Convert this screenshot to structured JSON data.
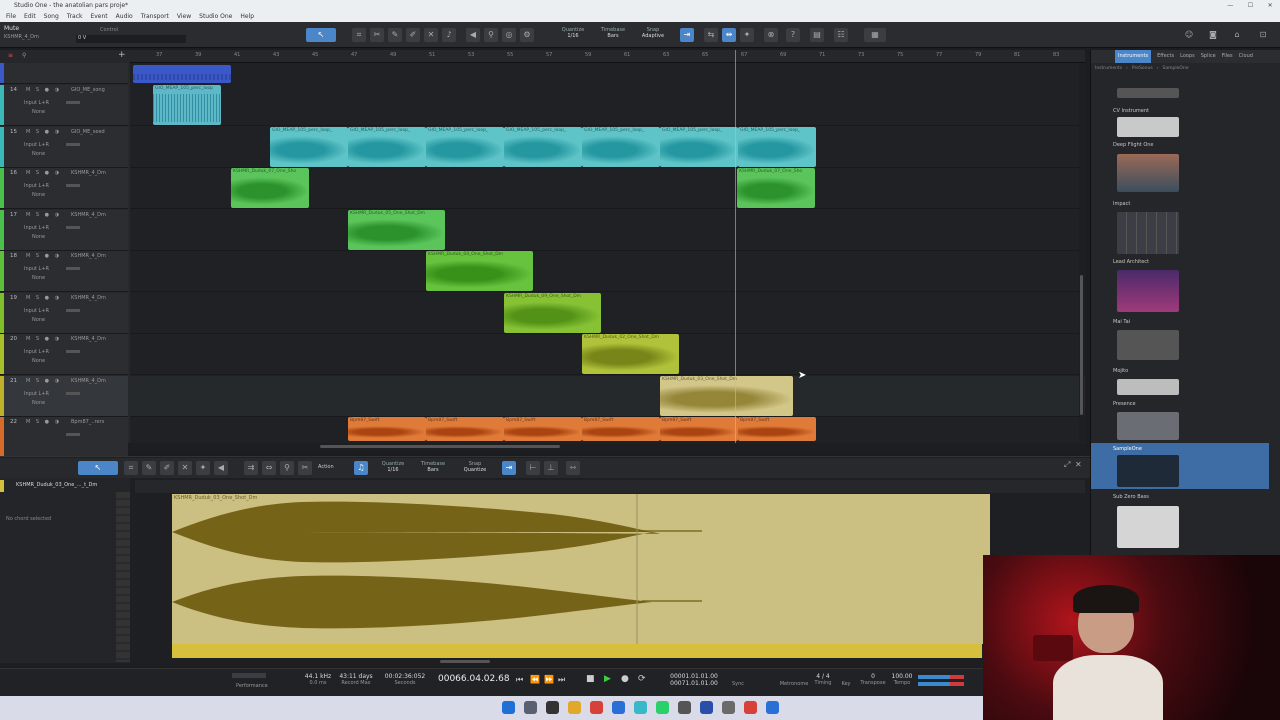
{
  "window": {
    "title": "Studio One - the anatolian pars proje*",
    "controls": [
      "—",
      "☐",
      "✕"
    ]
  },
  "menu": [
    "File",
    "Edit",
    "Song",
    "Track",
    "Event",
    "Audio",
    "Transport",
    "View",
    "Studio One",
    "Help"
  ],
  "selection": {
    "name": "Mute",
    "track": "KSHMR_4_Dm",
    "field_label": "Control",
    "field_value": "0 V"
  },
  "toolbar": {
    "quantize_label": "Quantize",
    "quantize_value": "1/16",
    "timebase_label": "Timebase",
    "timebase_value": "Bars",
    "snap_label": "Snap",
    "snap_value": "Adaptive"
  },
  "ruler": [
    "37",
    "39",
    "41",
    "43",
    "45",
    "47",
    "49",
    "51",
    "53",
    "55",
    "57",
    "59",
    "61",
    "63",
    "65",
    "67",
    "69",
    "71",
    "73",
    "75",
    "77",
    "79",
    "81",
    "83"
  ],
  "tracks": [
    {
      "num": "14",
      "name": "GIO_ME_song",
      "input": "Input L+R",
      "out": "None",
      "color": "#3ab7b7"
    },
    {
      "num": "15",
      "name": "GIO_ME_seed",
      "input": "Input L+R",
      "out": "None",
      "color": "#3ab7b7"
    },
    {
      "num": "16",
      "name": "KSHMR_4_Dm",
      "input": "Input L+R",
      "out": "None",
      "color": "#4bbf4b"
    },
    {
      "num": "17",
      "name": "KSHMR_4_Dm",
      "input": "Input L+R",
      "out": "None",
      "color": "#4bbf4b"
    },
    {
      "num": "18",
      "name": "KSHMR_4_Dm",
      "input": "Input L+R",
      "out": "None",
      "color": "#5ebf3a"
    },
    {
      "num": "19",
      "name": "KSHMR_4_Dm",
      "input": "Input L+R",
      "out": "None",
      "color": "#7fbf2a"
    },
    {
      "num": "20",
      "name": "KSHMR_4_Dm",
      "input": "Input L+R",
      "out": "None",
      "color": "#a9bf2a"
    },
    {
      "num": "21",
      "name": "KSHMR_4_Dm",
      "input": "Input L+R",
      "out": "None",
      "color": "#bfb02a"
    },
    {
      "num": "22",
      "name": "Bpm87_..rers",
      "input": "",
      "out": "",
      "color": "#d66a2a"
    }
  ],
  "clips": {
    "top": "",
    "t14": "GIO_MEAP_105_perc_loop",
    "t15": "GIO_MEAP_105_perc_loop_",
    "t16": "KSHMR_Duduk_07_One_Sho",
    "t17": "KSHMR_Duduk_05_One_Shot_Dm",
    "t18": "KSHMR_Duduk_04_One_Shot_Dm",
    "t19": "KSHMR_Duduk_09_One_Shot_Dm",
    "t20": "KSHMR_Duduk_02_One_Shot_Dm",
    "t21": "KSHMR_Duduk_03_One_Shot_Dm",
    "t22": "Bpm87_Swift"
  },
  "editor": {
    "track": "KSHMR_Duduk_03_One_..._t_Dm",
    "chord": "No chord selected",
    "quantize_label": "Quantize",
    "quantize_value": "1/16",
    "timebase_label": "Timebase",
    "timebase_value": "Bars",
    "snap_label": "Snap",
    "snap_value": "Quantize",
    "action": "Action",
    "clip_title": "KSHMR_Duduk_03_One_Shot_Dm"
  },
  "browser": {
    "tabs": [
      "Instruments",
      "Effects",
      "Loops",
      "Splice",
      "Files",
      "Cloud"
    ],
    "path": [
      "Instruments",
      "PreSonus",
      "SampleOne"
    ],
    "items": [
      "CV Instrument",
      "Deep Flight One",
      "Impact",
      "Lead Architect",
      "Mai Tai",
      "Mojito",
      "Presence",
      "SampleOne",
      "Sub Zero Bass"
    ]
  },
  "transport": {
    "samplerate": "44.1 kHz",
    "latency": "0.0 ms",
    "record_max": "43:11 days",
    "seconds": "00:02:36:052",
    "position": "00066.04.02.68",
    "loop_start": "00001.01.01.00",
    "loop_end": "00071.01.01.00",
    "timesig": "4 / 4",
    "tempo": "100.00",
    "key": "0",
    "perf": "Performance",
    "record_label": "Record Max",
    "sec_label": "Seconds",
    "sync": "Sync",
    "metronome": "Metronome",
    "timing": "Timing",
    "key_label": "Key",
    "transpose": "Transpose",
    "tempo_label": "Tempo"
  },
  "colors": {
    "accent": "#4a86c8",
    "teal": "#3ab7b7",
    "green": "#4bbf4b",
    "sand": "#cbbf82",
    "orange": "#d66a2a"
  }
}
